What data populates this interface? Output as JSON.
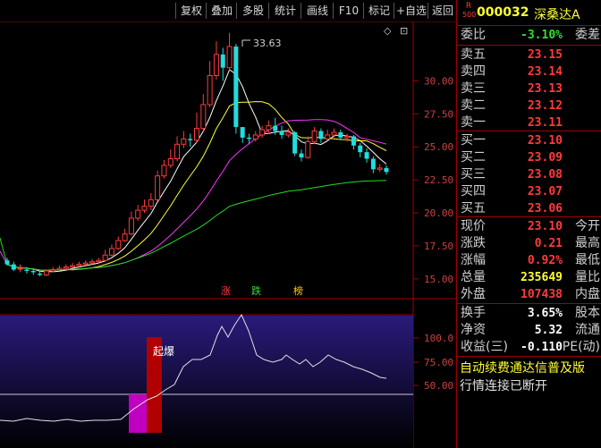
{
  "toolbar": {
    "buttons": [
      "复权",
      "叠加",
      "多股",
      "统计",
      "画线",
      "F10",
      "标记",
      "+自选",
      "返回"
    ]
  },
  "price_chart": {
    "high_label": "33.63",
    "axis_ticks": [
      "30.00",
      "27.50",
      "25.00",
      "22.50",
      "20.00",
      "17.50",
      "15.00"
    ],
    "markers": [
      {
        "text": "涨",
        "color": "#ff3b3b"
      },
      {
        "text": "跌",
        "color": "#33dd33"
      },
      {
        "text": "榜",
        "color": "#ffcc00"
      }
    ]
  },
  "indicator": {
    "axis_ticks": [
      "100.0",
      "75.00",
      "50.00"
    ],
    "annotation": "起爆"
  },
  "chart_data": {
    "type": "candlestick",
    "ylim": [
      13.5,
      34.5
    ],
    "candles": [
      [
        16.4,
        16.1,
        16.6,
        16.0
      ],
      [
        16.1,
        15.7,
        16.3,
        15.6
      ],
      [
        15.8,
        15.8,
        16.1,
        15.5
      ],
      [
        15.7,
        15.6,
        15.9,
        15.4
      ],
      [
        15.6,
        15.5,
        15.8,
        15.3
      ],
      [
        15.4,
        15.3,
        15.6,
        15.2
      ],
      [
        15.3,
        15.6,
        15.7,
        15.2
      ],
      [
        15.6,
        15.7,
        15.9,
        15.5
      ],
      [
        15.7,
        15.8,
        16.0,
        15.6
      ],
      [
        15.8,
        15.9,
        16.1,
        15.7
      ],
      [
        15.9,
        16.0,
        16.2,
        15.8
      ],
      [
        16.0,
        16.1,
        16.3,
        15.9
      ],
      [
        16.1,
        16.2,
        16.4,
        16.0
      ],
      [
        16.2,
        16.3,
        16.5,
        16.1
      ],
      [
        16.3,
        16.4,
        16.6,
        16.2
      ],
      [
        16.4,
        16.8,
        17.2,
        16.3
      ],
      [
        16.8,
        17.3,
        17.6,
        16.7
      ],
      [
        17.3,
        17.9,
        18.2,
        17.2
      ],
      [
        17.9,
        18.4,
        18.8,
        17.8
      ],
      [
        18.4,
        19.6,
        20.1,
        18.3
      ],
      [
        19.6,
        20.2,
        20.6,
        19.4
      ],
      [
        20.2,
        20.5,
        21.0,
        20.0
      ],
      [
        20.5,
        21.0,
        21.5,
        20.2
      ],
      [
        21.0,
        22.8,
        23.2,
        20.9
      ],
      [
        22.8,
        23.6,
        24.0,
        22.6
      ],
      [
        23.6,
        24.1,
        24.8,
        23.4
      ],
      [
        24.1,
        25.2,
        25.8,
        23.9
      ],
      [
        25.2,
        25.6,
        26.2,
        24.9
      ],
      [
        25.6,
        25.5,
        26.0,
        25.0
      ],
      [
        25.5,
        26.4,
        27.6,
        25.3
      ],
      [
        26.4,
        28.2,
        29.0,
        26.2
      ],
      [
        28.2,
        30.4,
        31.5,
        28.0
      ],
      [
        30.4,
        32.0,
        33.0,
        30.1
      ],
      [
        32.0,
        31.0,
        32.5,
        30.0
      ],
      [
        31.0,
        32.6,
        33.63,
        30.8
      ],
      [
        32.6,
        26.5,
        32.8,
        26.0
      ],
      [
        26.5,
        25.7,
        26.5,
        25.3
      ],
      [
        25.7,
        25.6,
        26.0,
        25.2
      ],
      [
        25.6,
        25.9,
        26.2,
        25.4
      ],
      [
        25.9,
        26.3,
        26.6,
        25.7
      ],
      [
        26.3,
        26.6,
        27.0,
        26.0
      ],
      [
        26.6,
        26.2,
        27.2,
        25.9
      ],
      [
        26.2,
        25.9,
        26.6,
        25.6
      ],
      [
        25.9,
        26.1,
        26.4,
        25.7
      ],
      [
        26.1,
        24.5,
        26.2,
        24.3
      ],
      [
        24.5,
        24.2,
        24.8,
        23.9
      ],
      [
        24.2,
        25.4,
        25.8,
        24.1
      ],
      [
        25.4,
        26.2,
        26.5,
        25.2
      ],
      [
        26.2,
        25.6,
        26.4,
        25.3
      ],
      [
        25.6,
        25.9,
        26.3,
        25.5
      ],
      [
        25.9,
        26.1,
        26.4,
        25.7
      ],
      [
        26.1,
        25.7,
        26.3,
        25.5
      ],
      [
        25.7,
        25.8,
        26.0,
        25.4
      ],
      [
        25.8,
        25.1,
        25.9,
        24.8
      ],
      [
        25.1,
        24.6,
        25.3,
        24.2
      ],
      [
        24.6,
        24.1,
        24.9,
        23.8
      ],
      [
        24.1,
        23.3,
        24.3,
        23.0
      ],
      [
        23.3,
        23.4,
        23.7,
        23.1
      ],
      [
        23.4,
        23.1,
        23.6,
        22.9
      ]
    ]
  },
  "quote": {
    "code": "000032",
    "name": "深桑达A",
    "badge_top": "R",
    "badge_bottom": "500",
    "weibi_label": "委比",
    "weibi_value": "-3.10%",
    "weicha_label": "委差",
    "asks": [
      {
        "label": "卖五",
        "price": "23.15"
      },
      {
        "label": "卖四",
        "price": "23.14"
      },
      {
        "label": "卖三",
        "price": "23.13"
      },
      {
        "label": "卖二",
        "price": "23.12"
      },
      {
        "label": "卖一",
        "price": "23.11"
      }
    ],
    "bids": [
      {
        "label": "买一",
        "price": "23.10"
      },
      {
        "label": "买二",
        "price": "23.09"
      },
      {
        "label": "买三",
        "price": "23.08"
      },
      {
        "label": "买四",
        "price": "23.07"
      },
      {
        "label": "买五",
        "price": "23.06"
      }
    ],
    "stats": [
      {
        "label": "现价",
        "value": "23.10",
        "label2": "今开",
        "color": "red"
      },
      {
        "label": "涨跌",
        "value": "0.21",
        "label2": "最高",
        "color": "red"
      },
      {
        "label": "涨幅",
        "value": "0.92%",
        "label2": "最低",
        "color": "red"
      },
      {
        "label": "总量",
        "value": "235649",
        "label2": "量比",
        "color": "yellow"
      },
      {
        "label": "外盘",
        "value": "107438",
        "label2": "内盘",
        "color": "red"
      }
    ],
    "stats2": [
      {
        "label": "换手",
        "value": "3.65%",
        "label2": "股本",
        "color": "white"
      },
      {
        "label": "净资",
        "value": "5.32",
        "label2": "流通",
        "color": "white"
      },
      {
        "label": "收益(三)",
        "value": "-0.110",
        "label2": "PE(动)",
        "color": "white"
      }
    ],
    "ticker_text": "自动续费通达信普及版",
    "status_text": "行情连接已断开"
  }
}
